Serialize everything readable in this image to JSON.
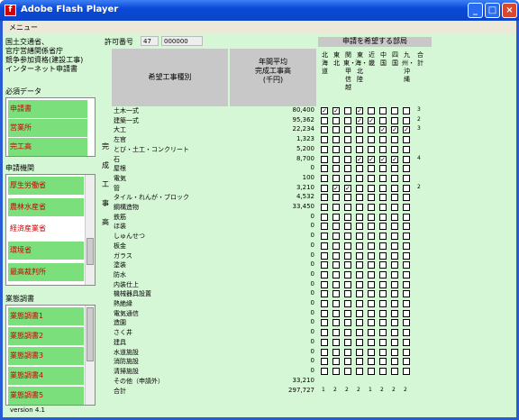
{
  "window": {
    "title": "Adobe Flash Player",
    "app_icon": "flash-icon"
  },
  "menu": {
    "label": "メニュー"
  },
  "side": {
    "agency": "国土交通省、\n官庁営繕関係省庁\n競争参加資格(建設工事)\nインターネット申請書",
    "required_title": "必須データ",
    "required_items": [
      "申請書",
      "営業所",
      "完工高"
    ],
    "org_title": "申請機関",
    "org_items": [
      "厚生労働省",
      "農林水産省",
      "経済産業省",
      "環境省",
      "最高裁判所"
    ],
    "org_selected": 2,
    "survey_title": "業態調書",
    "survey_items": [
      "業態調書1",
      "業態調書2",
      "業態調書3",
      "業態調書4",
      "業態調書5"
    ],
    "version": "version 4.1"
  },
  "header": {
    "permit_label": "許可番号",
    "permit_prefix": "47",
    "permit_number": "000000",
    "type_header": "希望工事種別",
    "avg_header": "年間平均\n完成工事高\n(千円)",
    "dept_header": "申請を希望する部局",
    "depts": [
      "北海道",
      "東北",
      "関東・甲信越",
      "東海・北陸",
      "近畿",
      "中国",
      "四国",
      "九州・沖縄",
      "合計"
    ],
    "side_label": "完成工事高"
  },
  "rows": [
    {
      "name": "土木一式",
      "value": "80,400",
      "checks": [
        1,
        1,
        0,
        1,
        0,
        0,
        0,
        0
      ],
      "total": "3"
    },
    {
      "name": "建築一式",
      "value": "95,362",
      "checks": [
        0,
        0,
        0,
        1,
        1,
        0,
        0,
        0
      ],
      "total": "2"
    },
    {
      "name": "大工",
      "value": "22,234",
      "checks": [
        0,
        0,
        0,
        0,
        0,
        1,
        1,
        1
      ],
      "total": "3"
    },
    {
      "name": "左官",
      "value": "1,323",
      "checks": [
        0,
        0,
        0,
        0,
        0,
        0,
        0,
        0
      ],
      "total": ""
    },
    {
      "name": "とび・土工・コンクリート",
      "value": "5,200",
      "checks": [
        0,
        0,
        0,
        0,
        0,
        0,
        0,
        0
      ],
      "total": ""
    },
    {
      "name": "石",
      "value": "8,700",
      "checks": [
        0,
        0,
        0,
        1,
        1,
        1,
        1,
        0
      ],
      "total": "4"
    },
    {
      "name": "屋根",
      "value": "0",
      "checks": [
        0,
        0,
        0,
        0,
        0,
        0,
        0,
        0
      ],
      "total": ""
    },
    {
      "name": "電気",
      "value": "100",
      "checks": [
        0,
        0,
        0,
        0,
        0,
        0,
        0,
        0
      ],
      "total": ""
    },
    {
      "name": "管",
      "value": "3,210",
      "checks": [
        0,
        1,
        1,
        0,
        0,
        0,
        0,
        0
      ],
      "total": "2"
    },
    {
      "name": "タイル・れんが・ブロック",
      "value": "4,532",
      "checks": [
        0,
        0,
        0,
        0,
        0,
        0,
        0,
        0
      ],
      "total": ""
    },
    {
      "name": "鋼構造物",
      "value": "33,450",
      "checks": [
        0,
        0,
        0,
        0,
        0,
        0,
        0,
        0
      ],
      "total": ""
    },
    {
      "name": "鉄筋",
      "value": "0",
      "checks": [
        0,
        0,
        0,
        0,
        0,
        0,
        0,
        0
      ],
      "total": ""
    },
    {
      "name": "ほ装",
      "value": "0",
      "checks": [
        0,
        0,
        0,
        0,
        0,
        0,
        0,
        0
      ],
      "total": ""
    },
    {
      "name": "しゅんせつ",
      "value": "0",
      "checks": [
        0,
        0,
        0,
        0,
        0,
        0,
        0,
        0
      ],
      "total": ""
    },
    {
      "name": "板金",
      "value": "0",
      "checks": [
        0,
        0,
        0,
        0,
        0,
        0,
        0,
        0
      ],
      "total": ""
    },
    {
      "name": "ガラス",
      "value": "0",
      "checks": [
        0,
        0,
        0,
        0,
        0,
        0,
        0,
        0
      ],
      "total": ""
    },
    {
      "name": "塗装",
      "value": "0",
      "checks": [
        0,
        0,
        0,
        0,
        0,
        0,
        0,
        0
      ],
      "total": ""
    },
    {
      "name": "防水",
      "value": "0",
      "checks": [
        0,
        0,
        0,
        0,
        0,
        0,
        0,
        0
      ],
      "total": ""
    },
    {
      "name": "内装仕上",
      "value": "0",
      "checks": [
        0,
        0,
        0,
        0,
        0,
        0,
        0,
        0
      ],
      "total": ""
    },
    {
      "name": "機械器具設置",
      "value": "0",
      "checks": [
        0,
        0,
        0,
        0,
        0,
        0,
        0,
        0
      ],
      "total": ""
    },
    {
      "name": "熱絶縁",
      "value": "0",
      "checks": [
        0,
        0,
        0,
        0,
        0,
        0,
        0,
        0
      ],
      "total": ""
    },
    {
      "name": "電気通信",
      "value": "0",
      "checks": [
        0,
        0,
        0,
        0,
        0,
        0,
        0,
        0
      ],
      "total": ""
    },
    {
      "name": "造園",
      "value": "0",
      "checks": [
        0,
        0,
        0,
        0,
        0,
        0,
        0,
        0
      ],
      "total": ""
    },
    {
      "name": "さく井",
      "value": "0",
      "checks": [
        0,
        0,
        0,
        0,
        0,
        0,
        0,
        0
      ],
      "total": ""
    },
    {
      "name": "建具",
      "value": "0",
      "checks": [
        0,
        0,
        0,
        0,
        0,
        0,
        0,
        0
      ],
      "total": ""
    },
    {
      "name": "水道施設",
      "value": "0",
      "checks": [
        0,
        0,
        0,
        0,
        0,
        0,
        0,
        0
      ],
      "total": ""
    },
    {
      "name": "消防施設",
      "value": "0",
      "checks": [
        0,
        0,
        0,
        0,
        0,
        0,
        0,
        0
      ],
      "total": ""
    },
    {
      "name": "清掃施設",
      "value": "0",
      "checks": [
        0,
        0,
        0,
        0,
        0,
        0,
        0,
        0
      ],
      "total": ""
    }
  ],
  "other": {
    "name": "その他（申請外）",
    "value": "33,210"
  },
  "sum": {
    "name": "合計",
    "value": "297,727",
    "dept_totals": [
      "1",
      "2",
      "2",
      "2",
      "1",
      "2",
      "2",
      "2"
    ]
  }
}
